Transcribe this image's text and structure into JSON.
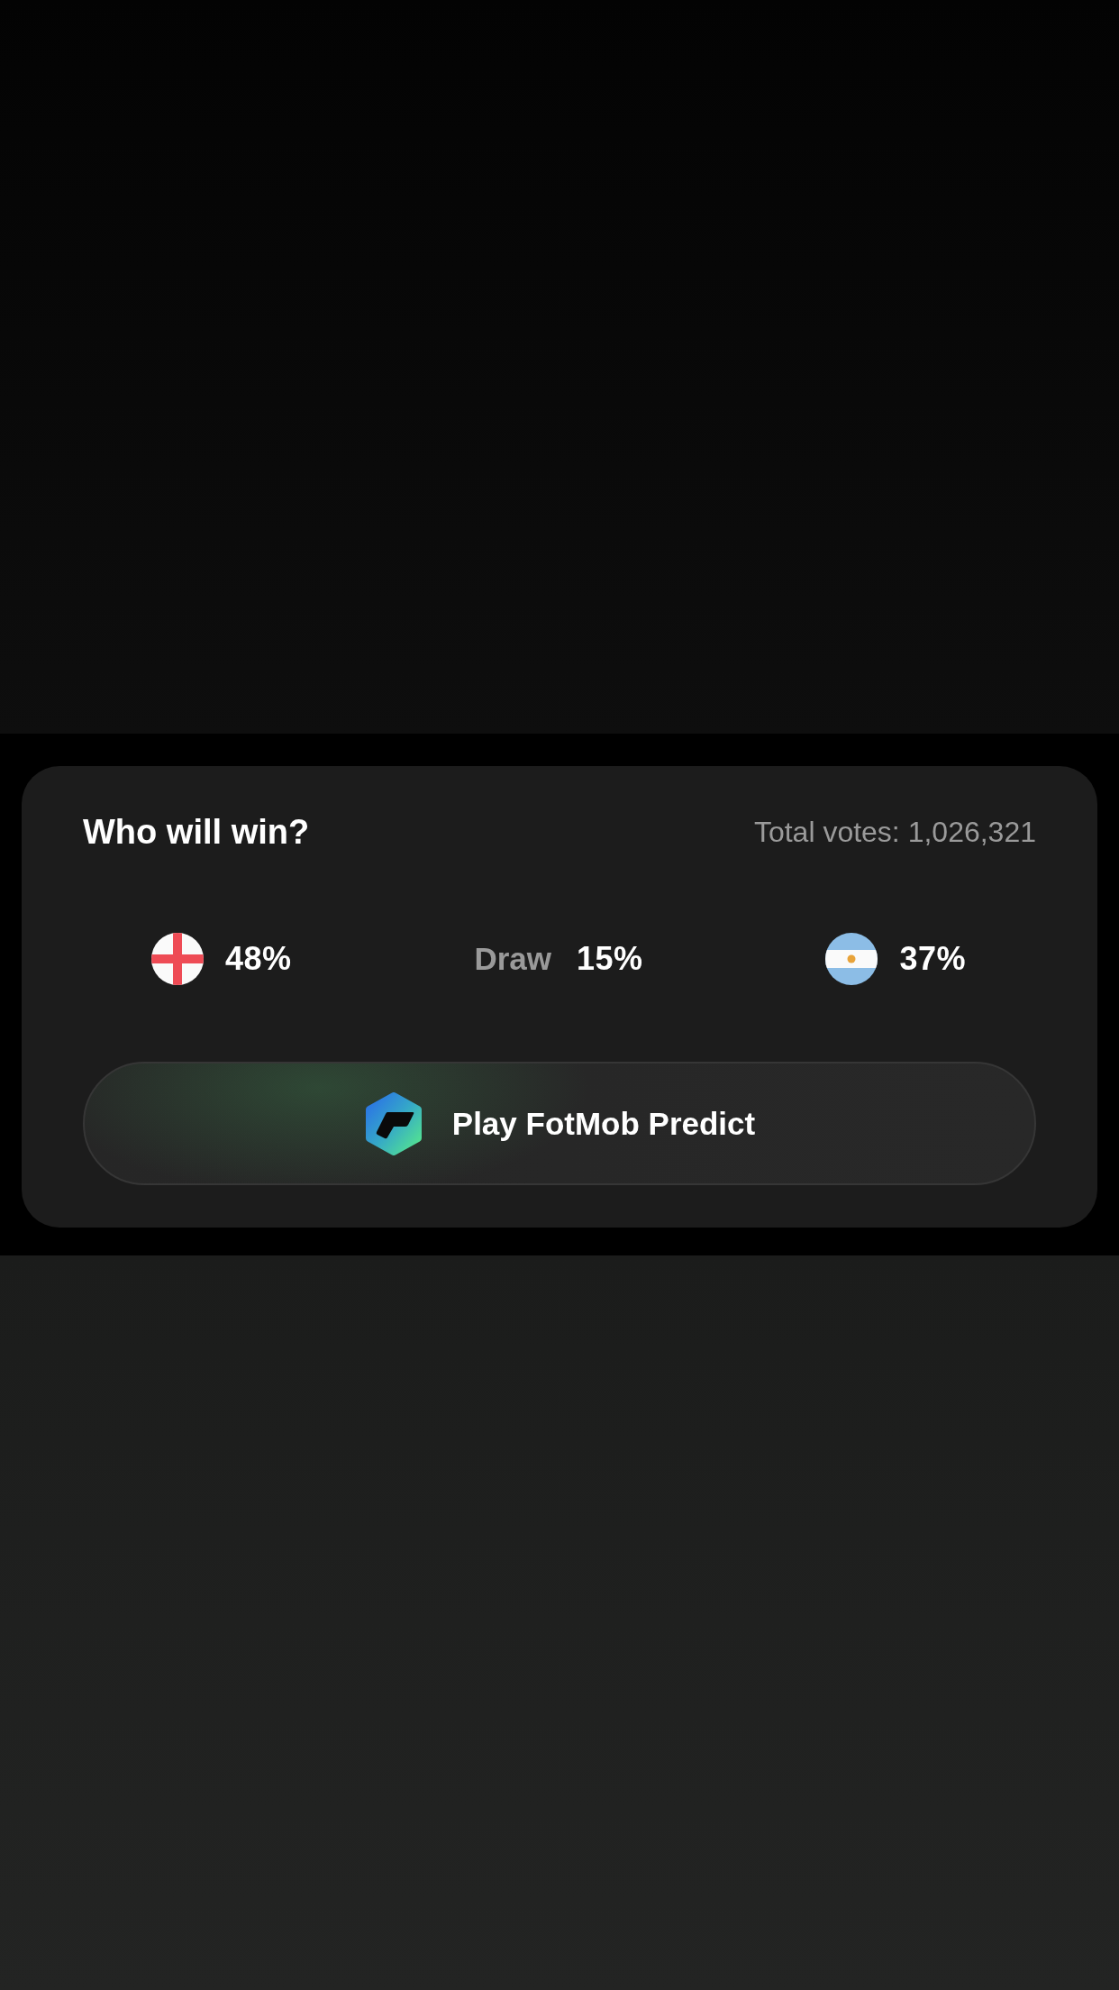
{
  "poll": {
    "title": "Who will win?",
    "total_votes": "Total votes: 1,026,321",
    "options": [
      {
        "kind": "home",
        "percent": "48%"
      },
      {
        "kind": "draw",
        "label": "Draw",
        "percent": "15%"
      },
      {
        "kind": "away",
        "percent": "37%"
      }
    ],
    "button": {
      "label": "Play FotMob Predict"
    }
  }
}
